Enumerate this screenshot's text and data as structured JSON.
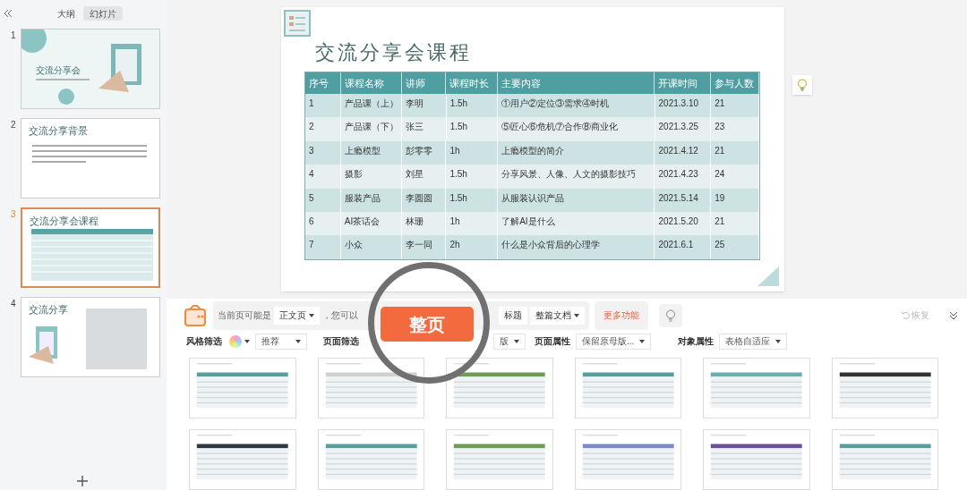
{
  "sidebar": {
    "tabs": [
      {
        "label": "大纲",
        "selected": false
      },
      {
        "label": "幻灯片",
        "selected": true
      }
    ],
    "slides": [
      {
        "number": "1",
        "title": "交流分享会",
        "kind": "cover",
        "selected": false
      },
      {
        "number": "2",
        "title": "交流分享背景",
        "kind": "text",
        "selected": false
      },
      {
        "number": "3",
        "title": "交流分享会课程",
        "kind": "table",
        "selected": true
      },
      {
        "number": "4",
        "title": "交流分享",
        "kind": "photo",
        "selected": false
      }
    ]
  },
  "slide": {
    "title": "交流分享会课程",
    "table": {
      "columns": [
        "序号",
        "课程名称",
        "讲师",
        "课程时长",
        "主要内容",
        "开课时间",
        "参与人数"
      ],
      "rows": [
        [
          "1",
          "产品课（上）",
          "李明",
          "1.5h",
          "①用户②定位③需求④时机",
          "2021.3.10",
          "21"
        ],
        [
          "2",
          "产品课（下）",
          "张三",
          "1.5h",
          "⑤匠心⑥危机⑦合作⑧商业化",
          "2021.3.25",
          "23"
        ],
        [
          "3",
          "上瘾模型",
          "彭零零",
          "1h",
          "上瘾模型的简介",
          "2021.4.12",
          "21"
        ],
        [
          "4",
          "摄影",
          "刘星",
          "1.5h",
          "分享风景、人像、人文的摄影技巧",
          "2021.4.23",
          "24"
        ],
        [
          "5",
          "服装产品",
          "李圆圆",
          "1.5h",
          "从服装认识产品",
          "2021.5.14",
          "19"
        ],
        [
          "6",
          "AI茶话会",
          "林珊",
          "1h",
          "了解AI是什么",
          "2021.5.20",
          "21"
        ],
        [
          "7",
          "小众",
          "李一同",
          "2h",
          "什么是小众背后的心理学",
          "2021.6.1",
          "25"
        ]
      ]
    }
  },
  "assistant": {
    "prompt": "当前页可能是",
    "page_type": "正文页",
    "suggestion": "，您可以",
    "highlight_button": "整页",
    "options": [
      "标题",
      "整篇文档"
    ],
    "more_button": "更多功能",
    "undo": {
      "label": "恢复",
      "disabled": true
    }
  },
  "filters": [
    {
      "label": "风格筛选",
      "value": "推荐"
    },
    {
      "label": "页面筛选",
      "value": "版"
    },
    {
      "label": "页面属性",
      "value": "保留原母版..."
    },
    {
      "label": "对象属性",
      "value": "表格自适应"
    }
  ],
  "templates": [
    {
      "color": "#5a9ea0"
    },
    {
      "color": "#cfcfcf"
    },
    {
      "color": "#6f9a5a"
    },
    {
      "color": "#5a9ea0"
    },
    {
      "color": "#6aaeb0"
    },
    {
      "color": "#333333"
    },
    {
      "color": "#2f3a40"
    },
    {
      "color": "#5a9ea0"
    },
    {
      "color": "#6f9a5a"
    },
    {
      "color": "#7a8ad0"
    },
    {
      "color": "#6a4fa0"
    },
    {
      "color": "#5a9ea0"
    }
  ]
}
